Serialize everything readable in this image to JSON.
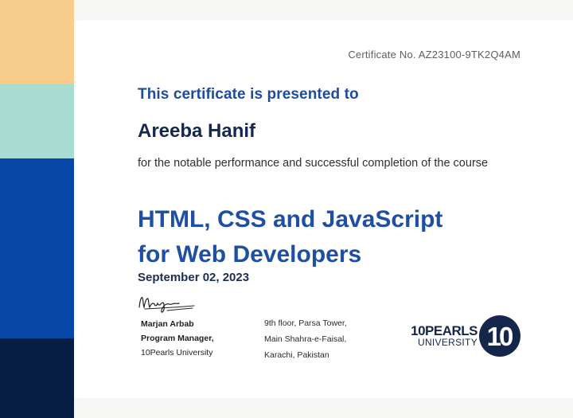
{
  "certificate": {
    "number": "Certificate No. AZ23100-9TK2Q4AM",
    "presented_to": "This certificate is presented to",
    "recipient": "Areeba Hanif",
    "description": "for the notable performance and successful completion of the course",
    "course_title_lines": [
      "HTML, CSS and JavaScript",
      "for Web Developers"
    ],
    "date": "September 02, 2023"
  },
  "signatory": {
    "signature_text": "Marjan",
    "name": "Marjan Arbab",
    "title": "Program Manager,",
    "organization": "10Pearls University"
  },
  "address": {
    "lines": [
      "9th floor, Parsa Tower,",
      "Main Shahra-e-Faisal,",
      "Karachi, Pakistan"
    ]
  },
  "logo": {
    "brand": "10PEARLS",
    "sub": "UNIVERSITY",
    "mark": "10"
  },
  "colors": {
    "stripe_1": "#f9ce8d",
    "stripe_2": "#a9ddd3",
    "stripe_3": "#0747a8",
    "stripe_4": "#071e44",
    "accent_blue": "#1f4fa3",
    "navy": "#13284f"
  }
}
